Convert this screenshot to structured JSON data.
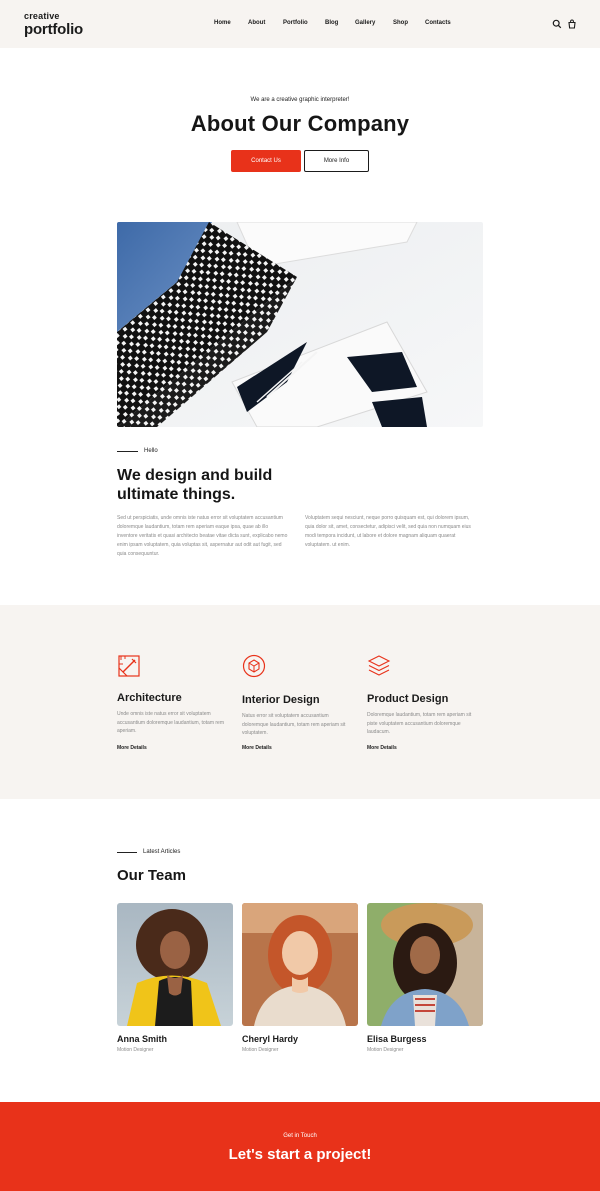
{
  "brand": {
    "line1": "creative",
    "line2": "portfolio"
  },
  "nav": {
    "items": [
      {
        "label": "Home"
      },
      {
        "label": "About"
      },
      {
        "label": "Portfolio"
      },
      {
        "label": "Blog"
      },
      {
        "label": "Gallery"
      },
      {
        "label": "Shop"
      },
      {
        "label": "Contacts"
      }
    ],
    "icons": [
      "search-icon",
      "cart-icon"
    ]
  },
  "hero": {
    "subtitle": "We are a creative graphic interpreter!",
    "title": "About Our Company",
    "primary_button": "Contact Us",
    "secondary_button": "More Info"
  },
  "intro": {
    "eyebrow": "Hello",
    "title": "We design and build ultimate things.",
    "paragraph_left": "Sed ut perspiciatis, unde omnis iste natus error sit voluptatem accusantium doloremque laudantium, totam rem aperiam eaque ipsa, quae ab illo inventore veritatis et quasi architecto beatae vitae dicta sunt, explicabo nemo enim ipsam voluptatem, quia voluptas sit, aspernatur aut odit aut fugit, sed quia consequuntur.",
    "paragraph_right": "Voluptatem sequi nesciunt, neque porro quisquam est, qui dolorem ipsum, quia dolor sit, amet, consectetur, adipisci velit, sed quia non numquam eius modi tempora incidunt, ut labore et dolore magnam aliquam quaerat voluptatem. ut enim."
  },
  "services": [
    {
      "icon": "architecture-icon",
      "title": "Architecture",
      "desc": "Unde omnis iste natus error sit voluptatem accusantium doloremque laudantium, totam rem aperiam.",
      "link": "More Details"
    },
    {
      "icon": "interior-design-icon",
      "title": "Interior Design",
      "desc": "Natus error sit voluptatem accusantium doloremque laudantium, totam rem aperiam sit voluptatem.",
      "link": "More Details"
    },
    {
      "icon": "product-design-icon",
      "title": "Product Design",
      "desc": "Doloremque laudantium, totam rem aperiam sit piste voluptatem accusantium doloremque laudacum.",
      "link": "More Details"
    }
  ],
  "team": {
    "eyebrow": "Latest Articles",
    "title": "Our Team",
    "members": [
      {
        "name": "Anna Smith",
        "role": "Motion Designer"
      },
      {
        "name": "Cheryl Hardy",
        "role": "Motion Designer"
      },
      {
        "name": "Elisa Burgess",
        "role": "Motion Designer"
      }
    ]
  },
  "cta": {
    "subtitle": "Get in Touch",
    "title": "Let's start a project!"
  },
  "colors": {
    "accent": "#e8321a",
    "band": "#f7f4f1",
    "text": "#1b1b1b",
    "muted": "#8a8a8a"
  }
}
